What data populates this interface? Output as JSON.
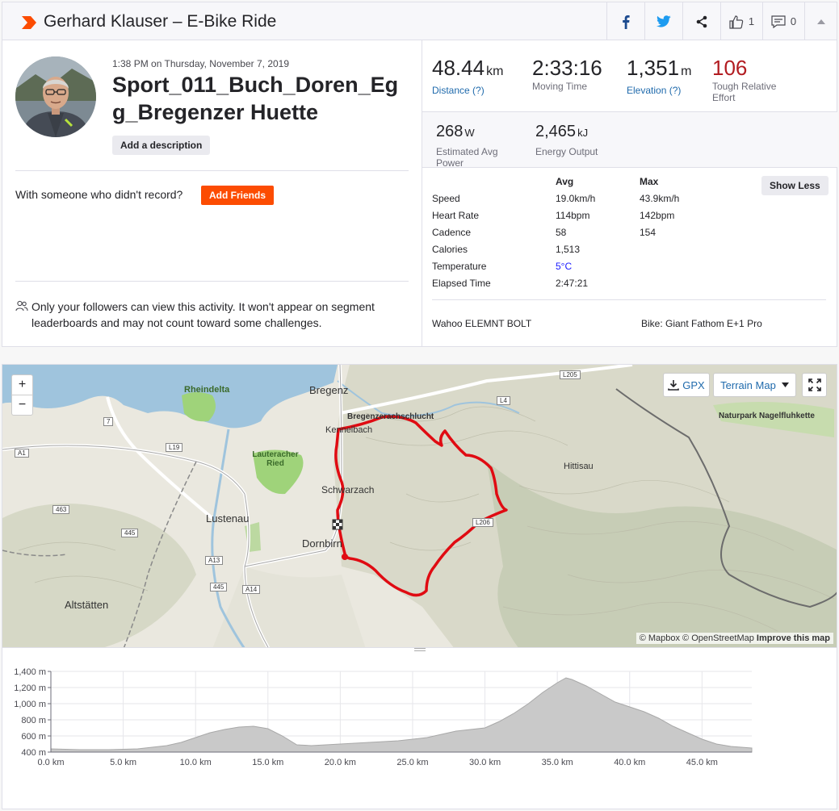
{
  "header": {
    "title": "Gerhard Klauser – E-Bike Ride",
    "kudos_count": "1",
    "comment_count": "0"
  },
  "activity": {
    "date": "1:38 PM on Thursday, November 7, 2019",
    "name": "Sport_011_Buch_Doren_Eg g_Bregenzer Huette",
    "add_description": "Add a description",
    "with_someone": "With someone who didn't record?",
    "add_friends": "Add Friends",
    "privacy": "Only your followers can view this activity. It won't appear on segment leaderboards and may not count toward some challenges."
  },
  "stats": {
    "distance": {
      "value": "48.44",
      "unit": "km",
      "label": "Distance (?)"
    },
    "moving_time": {
      "value": "2:33:16",
      "label": "Moving Time"
    },
    "elevation": {
      "value": "1,351",
      "unit": "m",
      "label": "Elevation (?)"
    },
    "relative_effort": {
      "value": "106",
      "label": "Tough Relative Effort"
    },
    "power": {
      "value": "268",
      "unit": "W",
      "label": "Estimated Avg Power"
    },
    "energy": {
      "value": "2,465",
      "unit": "kJ",
      "label": "Energy Output"
    }
  },
  "more_stats": {
    "col_avg": "Avg",
    "col_max": "Max",
    "show_less": "Show Less",
    "rows": [
      {
        "label": "Speed",
        "avg": "19.0km/h",
        "max": "43.9km/h"
      },
      {
        "label": "Heart Rate",
        "avg": "114bpm",
        "max": "142bpm"
      },
      {
        "label": "Cadence",
        "avg": "58",
        "max": "154"
      },
      {
        "label": "Calories",
        "avg": "1,513",
        "max": ""
      },
      {
        "label": "Temperature",
        "avg": "5°C",
        "max": ""
      },
      {
        "label": "Elapsed Time",
        "avg": "2:47:21",
        "max": ""
      }
    ],
    "device": "Wahoo ELEMNT BOLT",
    "bike": "Bike: Giant Fathom E+1 Pro"
  },
  "map": {
    "zoom_in": "+",
    "zoom_out": "−",
    "gpx": "GPX",
    "map_type": "Terrain Map",
    "attribution": "© Mapbox © OpenStreetMap",
    "improve": "Improve this map",
    "places": [
      "Bregenz",
      "Rheindelta",
      "Kennelbach",
      "Bregenzerachschlucht",
      "Lauteracher Ried",
      "Schwarzach",
      "Lustenau",
      "Dornbirn",
      "Altstätten",
      "Hittisau",
      "Naturpark Nagelfluhkette"
    ],
    "roads": [
      "L205",
      "L4",
      "7",
      "A1",
      "L19",
      "463",
      "445",
      "A13",
      "445",
      "A14",
      "L206"
    ]
  },
  "chart_data": {
    "type": "area",
    "title": "",
    "xlabel": "",
    "ylabel": "",
    "x_ticks": [
      "0.0 km",
      "5.0 km",
      "10.0 km",
      "15.0 km",
      "20.0 km",
      "25.0 km",
      "30.0 km",
      "35.0 km",
      "40.0 km",
      "45.0 km"
    ],
    "y_ticks": [
      "400 m",
      "600 m",
      "800 m",
      "1,000 m",
      "1,200 m",
      "1,400 m"
    ],
    "xlim": [
      0,
      48.44
    ],
    "ylim": [
      400,
      1400
    ],
    "x": [
      0,
      2,
      4,
      6,
      8,
      9,
      10,
      11,
      12,
      13,
      14,
      15,
      16,
      17,
      18,
      19,
      20,
      22,
      24,
      26,
      27,
      28,
      29,
      30,
      31,
      32,
      33,
      34,
      35,
      35.6,
      36,
      37,
      38,
      39,
      40,
      41,
      42,
      43,
      44,
      45,
      46,
      47,
      48.44
    ],
    "y": [
      440,
      430,
      430,
      440,
      480,
      520,
      580,
      640,
      680,
      710,
      720,
      690,
      600,
      490,
      480,
      490,
      500,
      520,
      540,
      580,
      620,
      660,
      680,
      700,
      780,
      880,
      1000,
      1140,
      1260,
      1320,
      1300,
      1220,
      1120,
      1020,
      960,
      900,
      820,
      720,
      640,
      560,
      500,
      470,
      450
    ]
  }
}
